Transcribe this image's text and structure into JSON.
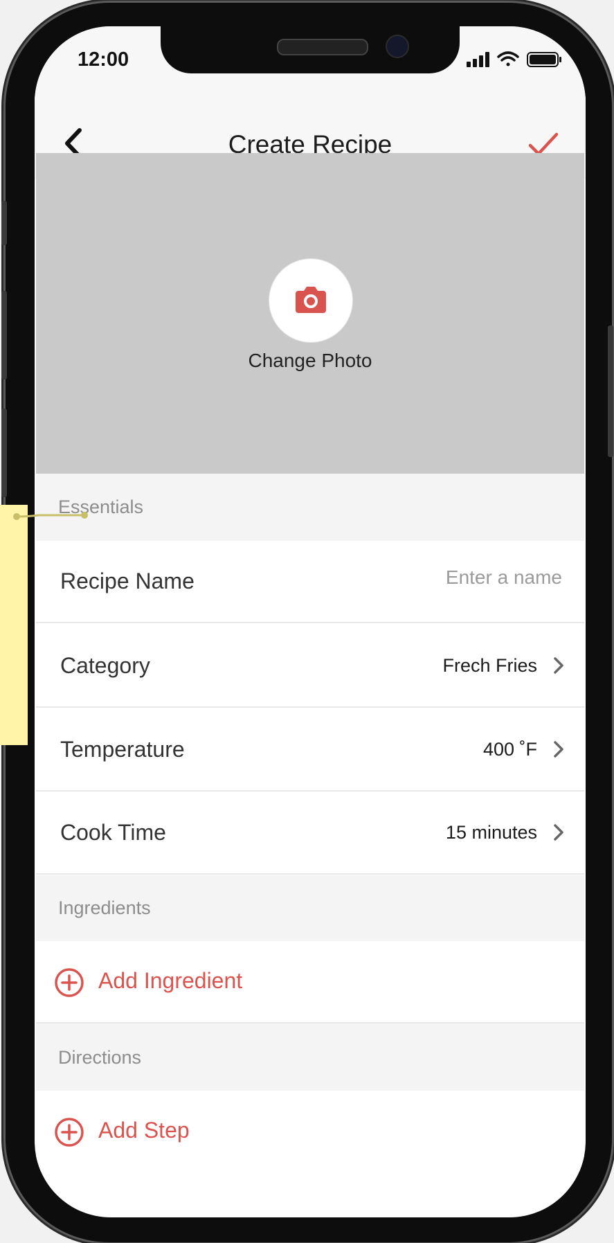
{
  "status_bar": {
    "time": "12:00"
  },
  "nav": {
    "title": "Create Recipe"
  },
  "photo": {
    "change_label": "Change Photo"
  },
  "sections": {
    "essentials": "Essentials",
    "ingredients": "Ingredients",
    "directions": "Directions"
  },
  "fields": {
    "recipe_name": {
      "label": "Recipe Name",
      "placeholder": "Enter a name",
      "value": ""
    },
    "category": {
      "label": "Category",
      "value": "Frech Fries"
    },
    "temperature": {
      "label": "Temperature",
      "value": "400 ˚F"
    },
    "cook_time": {
      "label": "Cook Time",
      "value": "15 minutes"
    }
  },
  "actions": {
    "add_ingredient": "Add Ingredient",
    "add_step": "Add Step"
  },
  "colors": {
    "accent": "#d9534f",
    "photo_bg": "#cac9ca",
    "section_bg": "#f4f4f4",
    "annotation_note": "#fff4a8"
  },
  "icons": [
    "back-icon",
    "checkmark-icon",
    "camera-icon",
    "chevron-right-icon",
    "add-circle-icon",
    "signal-icon",
    "wifi-icon",
    "battery-icon"
  ]
}
